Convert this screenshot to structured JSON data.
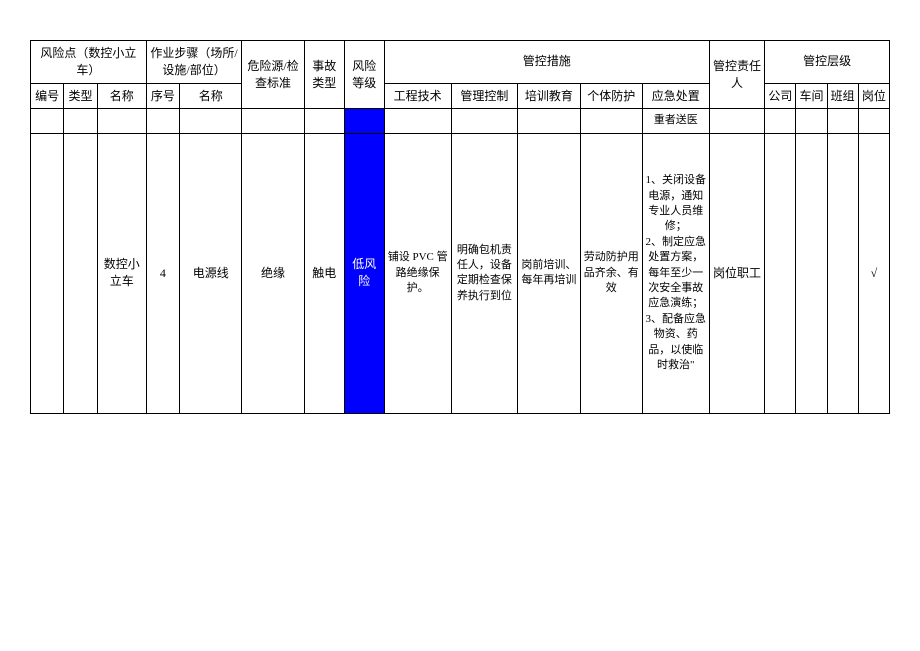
{
  "headers": {
    "risk_point_group": "风险点（数控小立车）",
    "work_step_group": "作业步骤（场所/设施/部位）",
    "hazard_check": "危险源/检查标准",
    "accident_type": "事故类型",
    "risk_level": "风险等级",
    "control_measures_group": "管控措施",
    "control_responsible": "管控责任人",
    "control_level_group": "管控层级",
    "number": "编号",
    "type": "类型",
    "name": "名称",
    "seq": "序号",
    "step_name": "名称",
    "engineering": "工程技术",
    "management": "管理控制",
    "training": "培训教育",
    "ppe": "个体防护",
    "emergency": "应急处置",
    "company": "公司",
    "workshop": "车间",
    "team": "班组",
    "position": "岗位"
  },
  "partial_row": {
    "emergency": "重者送医"
  },
  "main_row": {
    "name": "数控小立车",
    "seq": "4",
    "step_name": "电源线",
    "hazard": "绝缘",
    "accident_type": "触电",
    "risk_level": "低风险",
    "engineering": "铺设 PVC 管路绝缘保护。",
    "management": "明确包机责任人，设备定期检查保养执行到位",
    "training": "岗前培训、每年再培训",
    "ppe": "劳动防护用品齐余、有效",
    "emergency": "1、关闭设备电源，通知专业人员维修；\n2、制定应急处置方案，每年至少一次安全事故应急演练；\n3、配备应急物资、药品，以使临时救治\"",
    "responsible": "岗位职工",
    "company": "",
    "workshop": "",
    "team": "",
    "position": "√"
  }
}
